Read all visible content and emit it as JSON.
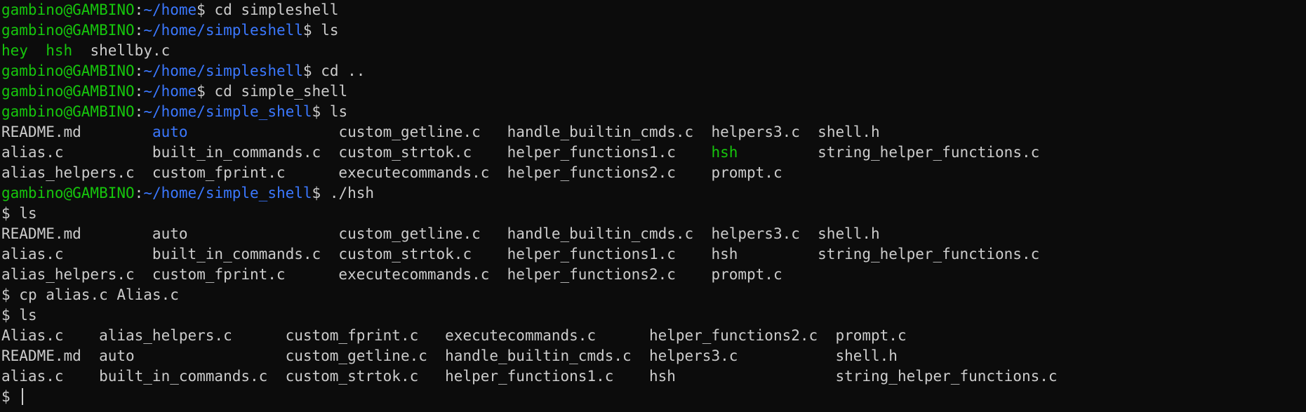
{
  "colors": {
    "background": "#0c0c0c",
    "foreground": "#cccccc",
    "user": "#16c60c",
    "path": "#3b78ff",
    "directory": "#3b78ff",
    "executable": "#16c60c"
  },
  "prompt": {
    "user_host": "gambino@GAMBINO",
    "sep": ":",
    "dollar": "$ ",
    "shell_prompt": "$ "
  },
  "lines": {
    "l1": {
      "path": "~/home",
      "cmd": "cd simpleshell"
    },
    "l2": {
      "path": "~/home/simpleshell",
      "cmd": "ls"
    },
    "l3": {
      "c1": "hey",
      "gap1": "  ",
      "c2": "hsh",
      "c3": "  shellby.c"
    },
    "l4": {
      "path": "~/home/simpleshell",
      "cmd": "cd .."
    },
    "l5": {
      "path": "~/home",
      "cmd": "cd simple_shell"
    },
    "l6": {
      "path": "~/home/simple_shell",
      "cmd": "ls"
    },
    "l7": {
      "a": "README.md        ",
      "b": "auto",
      "c": "                 custom_getline.c   handle_builtin_cmds.c  helpers3.c  shell.h"
    },
    "l8": {
      "a": "alias.c          built_in_commands.c  custom_strtok.c    helper_functions1.c    ",
      "b": "hsh",
      "c": "         string_helper_functions.c"
    },
    "l9": {
      "text": "alias_helpers.c  custom_fprint.c      executecommands.c  helper_functions2.c    prompt.c"
    },
    "l10": {
      "path": "~/home/simple_shell",
      "cmd": "./hsh"
    },
    "l11": {
      "cmd": "ls"
    },
    "l12": {
      "text": "README.md        auto                 custom_getline.c   handle_builtin_cmds.c  helpers3.c  shell.h"
    },
    "l13": {
      "text": "alias.c          built_in_commands.c  custom_strtok.c    helper_functions1.c    hsh         string_helper_functions.c"
    },
    "l14": {
      "text": "alias_helpers.c  custom_fprint.c      executecommands.c  helper_functions2.c    prompt.c"
    },
    "l15": {
      "cmd": "cp alias.c Alias.c"
    },
    "l16": {
      "cmd": "ls"
    },
    "l17": {
      "text": "Alias.c    alias_helpers.c      custom_fprint.c   executecommands.c      helper_functions2.c  prompt.c"
    },
    "l18": {
      "text": "README.md  auto                 custom_getline.c  handle_builtin_cmds.c  helpers3.c           shell.h"
    },
    "l19": {
      "text": "alias.c    built_in_commands.c  custom_strtok.c   helper_functions1.c    hsh                  string_helper_functions.c"
    }
  }
}
